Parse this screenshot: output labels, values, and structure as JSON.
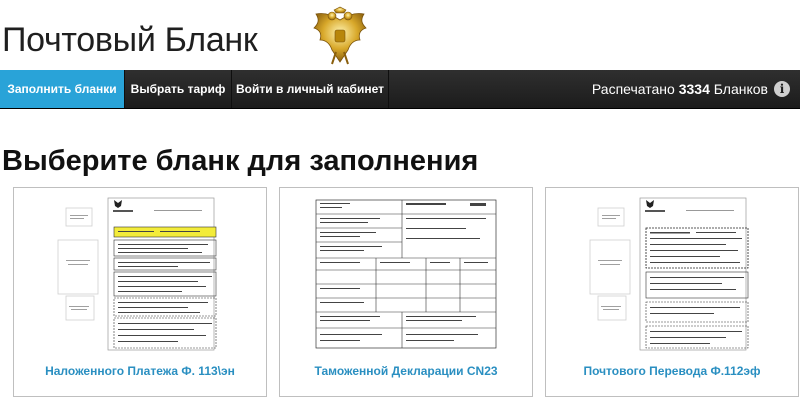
{
  "site": {
    "title": "Почтовый Бланк",
    "emblem_icon": "double-headed-eagle-emblem"
  },
  "nav": {
    "items": [
      {
        "label": "Заполнить бланки",
        "active": true
      },
      {
        "label": "Выбрать тариф",
        "active": false
      },
      {
        "label": "Войти в личный кабинет",
        "active": false
      }
    ],
    "counter_prefix": "Распечатано",
    "counter_value": "3334",
    "counter_suffix": "Бланков",
    "info_icon": "info-icon"
  },
  "main": {
    "heading": "Выберите бланк для заполнения",
    "cards": [
      {
        "label": "Наложенного Платежа Ф. 113\\эн"
      },
      {
        "label": "Таможенной Декларации CN23"
      },
      {
        "label": "Почтового Перевода Ф.112эф"
      }
    ]
  },
  "colors": {
    "accent": "#29a3d8",
    "navbar": "#1c1c1c",
    "link": "#2a8fc1",
    "form_highlight": "#f3ec3a"
  }
}
